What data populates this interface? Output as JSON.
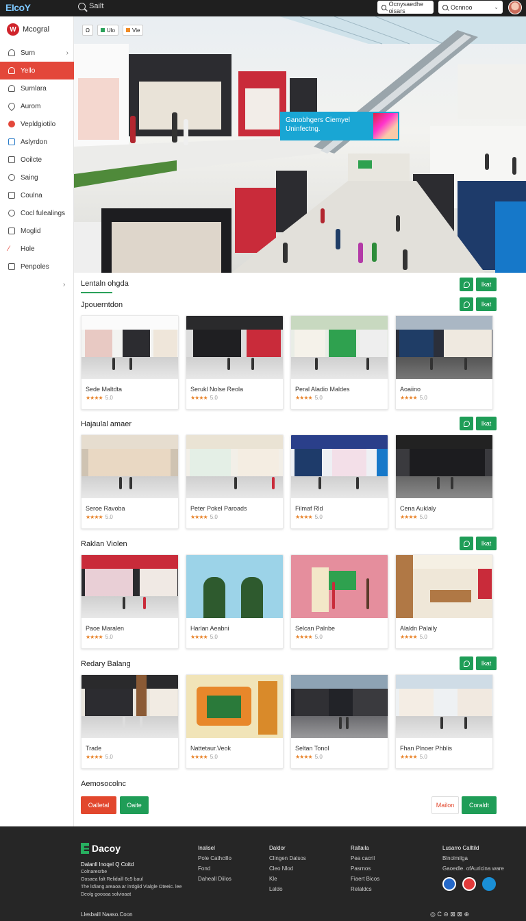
{
  "topbar": {
    "logo": "EIcoY",
    "search_label": "Sailt",
    "input1_placeholder": "Ocnysaedhe oisars",
    "input2_placeholder": "Ocnnoo"
  },
  "sidebar": {
    "brand": "Mcogral",
    "items": [
      {
        "label": "Surn",
        "icon": "person-icon",
        "arrow": "›"
      },
      {
        "label": "Yello",
        "icon": "person-icon",
        "active": true
      },
      {
        "label": "Surnlara",
        "icon": "person-icon"
      },
      {
        "label": "Aurom",
        "icon": "drop-icon"
      },
      {
        "label": "Vepldgiotilo",
        "icon": "dot-icon"
      },
      {
        "label": "Aslyrdon",
        "icon": "grid-icon"
      },
      {
        "label": "Ooilcte",
        "icon": "doc-icon"
      },
      {
        "label": "Saing",
        "icon": "gear-icon"
      },
      {
        "label": "Coulna",
        "icon": "chart-icon"
      },
      {
        "label": "Cocl fulealings",
        "icon": "circle-icon"
      },
      {
        "label": "Moglid",
        "icon": "mail-icon"
      },
      {
        "label": "Hole",
        "icon": "slash-icon"
      },
      {
        "label": "Penpoles",
        "icon": "square-icon"
      }
    ],
    "more": "›"
  },
  "hero": {
    "tools": [
      "Ω",
      "Ulo",
      "Vie"
    ],
    "banner_line1": "Ganobhgers Ciemyel",
    "banner_line2": "Uninfectng."
  },
  "content": {
    "tabs_label": "Lentaln ohgda",
    "action_label": "Ikat",
    "sections": [
      {
        "title": "Jpouerntdon",
        "cards": [
          {
            "name": "Sede Maltdta",
            "stars": "★★★★",
            "meta": "5.0"
          },
          {
            "name": "Serukl Nolse Reola",
            "stars": "★★★★",
            "meta": "5.0"
          },
          {
            "name": "Peral Aladio Maldes",
            "stars": "★★★★",
            "meta": "5.0"
          },
          {
            "name": "Aoaiino",
            "stars": "★★★★",
            "meta": "5.0"
          }
        ]
      },
      {
        "title": "Hajaulal amaer",
        "cards": [
          {
            "name": "Seroe Ravoba",
            "stars": "★★★★",
            "meta": "5.0"
          },
          {
            "name": "Peter Pokel Paroads",
            "stars": "★★★★",
            "meta": "5.0"
          },
          {
            "name": "Filmaf Rld",
            "stars": "★★★★",
            "meta": "5.0"
          },
          {
            "name": "Cena Auklaly",
            "stars": "★★★★",
            "meta": "5.0"
          }
        ]
      },
      {
        "title": "Raklan Violen",
        "cards": [
          {
            "name": "Paoe Maralen",
            "stars": "★★★★",
            "meta": "5.0"
          },
          {
            "name": "Harlan Aeabni",
            "stars": "★★★★",
            "meta": "5.0"
          },
          {
            "name": "Selcan Palnbe",
            "stars": "★★★★",
            "meta": "5.0"
          },
          {
            "name": "Alaldn Palaily",
            "stars": "★★★★",
            "meta": "5.0"
          }
        ]
      },
      {
        "title": "Redary Balang",
        "cards": [
          {
            "name": "Trade",
            "stars": "★★★★",
            "meta": "5.0"
          },
          {
            "name": "Nattetaur.Veok",
            "stars": "★★★★",
            "meta": "5.0"
          },
          {
            "name": "Seltan Tonol",
            "stars": "★★★★",
            "meta": "5.0"
          },
          {
            "name": "Fhan Plnoer Phblis",
            "stars": "★★★★",
            "meta": "5.0"
          }
        ]
      }
    ],
    "bottom_label": "Aemosocolnc",
    "btn_red": "Oalletal",
    "btn_green1": "Oaite",
    "btn_outline": "Mailon",
    "btn_green2": "Coraldt"
  },
  "footer": {
    "logo": "Dacoy",
    "info_title": "Dalanll lnoqel  Q Coitd",
    "info_lines": [
      "Colnaresrbe",
      "Oosaea falt Relidaill 6c5 baul",
      "The lsfiang areaoa ar irrdgiid Vialgle Oteeic. lee",
      "Deolg goooaa solvioaat"
    ],
    "col1": [
      "Inalisel",
      "Pole Cathcillo",
      "Fond",
      "Daheall Diilos"
    ],
    "col2": [
      "Daldor",
      "Clingen Dalsos",
      "Cleo  Nlod",
      "Kle",
      "Laldo"
    ],
    "col3": [
      "Raltaila",
      "Pea cacril",
      "Pasrnos",
      "Fiaert Bicos",
      "Relaldcs"
    ],
    "col4": [
      "Lusarro Calltild",
      "Blnolmilga",
      "Gaoedle. ofAuricina ware"
    ],
    "bottom": "Llesbaill Naaso.Coon",
    "bottom_icons": "◎ C ⊝ ⊠   ⊠ ⊕"
  },
  "colors": {
    "accent_red": "#e3473a",
    "accent_green": "#1f9d57",
    "topbar_bg": "#1f1f1f",
    "footer_bg": "#262626"
  }
}
